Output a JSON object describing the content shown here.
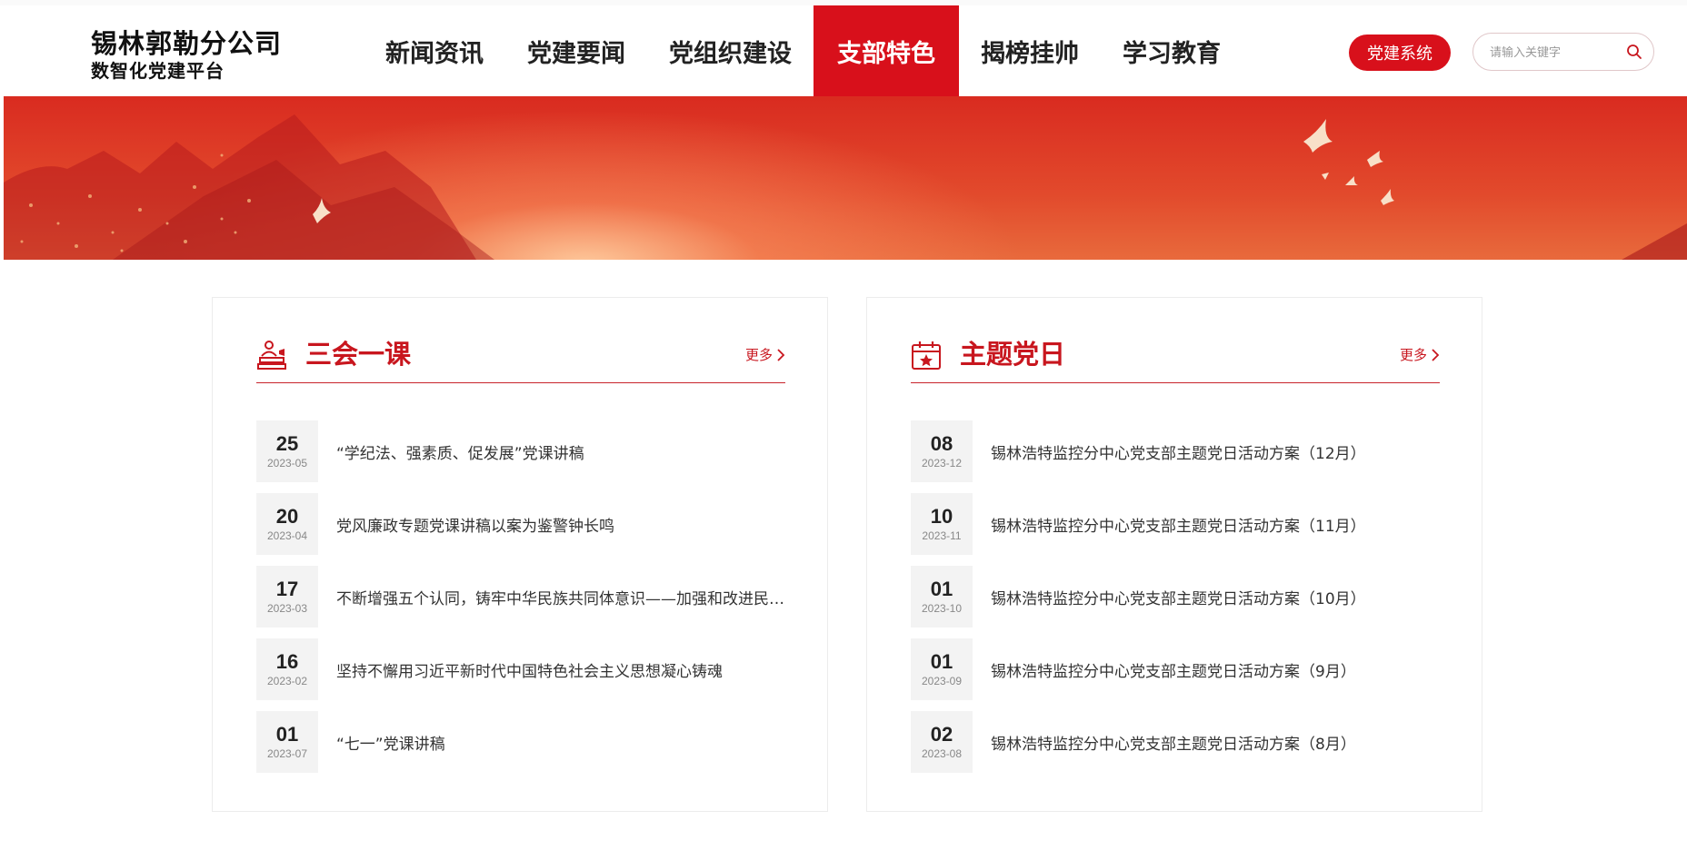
{
  "brand": {
    "line1": "锡林郭勒分公司",
    "line2": "数智化党建平台",
    "accent_color": "#d8101b"
  },
  "nav": {
    "items": [
      {
        "label": "新闻资讯",
        "active": false
      },
      {
        "label": "党建要闻",
        "active": false
      },
      {
        "label": "党组织建设",
        "active": false
      },
      {
        "label": "支部特色",
        "active": true
      },
      {
        "label": "揭榜挂帅",
        "active": false
      },
      {
        "label": "学习教育",
        "active": false
      }
    ]
  },
  "header": {
    "party_system_label": "党建系统",
    "search_placeholder": "请输入关键字",
    "search_icon": "search-icon"
  },
  "left_card": {
    "title": "三会一课",
    "icon": "meeting-podium-icon",
    "more_label": "更多",
    "items": [
      {
        "day": "25",
        "ym": "2023-05",
        "title": "“学纪法、强素质、促发展”党课讲稿"
      },
      {
        "day": "20",
        "ym": "2023-04",
        "title": "党风廉政专题党课讲稿以案为鉴警钟长鸣"
      },
      {
        "day": "17",
        "ym": "2023-03",
        "title": "不断增强五个认同，铸牢中华民族共同体意识——加强和改进民族工作"
      },
      {
        "day": "16",
        "ym": "2023-02",
        "title": "坚持不懈用习近平新时代中国特色社会主义思想凝心铸魂"
      },
      {
        "day": "01",
        "ym": "2023-07",
        "title": "“七一”党课讲稿"
      }
    ]
  },
  "right_card": {
    "title": "主题党日",
    "icon": "calendar-star-icon",
    "more_label": "更多",
    "items": [
      {
        "day": "08",
        "ym": "2023-12",
        "title": "锡林浩特监控分中心党支部主题党日活动方案（12月）"
      },
      {
        "day": "10",
        "ym": "2023-11",
        "title": "锡林浩特监控分中心党支部主题党日活动方案（11月）"
      },
      {
        "day": "01",
        "ym": "2023-10",
        "title": "锡林浩特监控分中心党支部主题党日活动方案（10月）"
      },
      {
        "day": "01",
        "ym": "2023-09",
        "title": "锡林浩特监控分中心党支部主题党日活动方案（9月）"
      },
      {
        "day": "02",
        "ym": "2023-08",
        "title": "锡林浩特监控分中心党支部主题党日活动方案（8月）"
      }
    ]
  }
}
